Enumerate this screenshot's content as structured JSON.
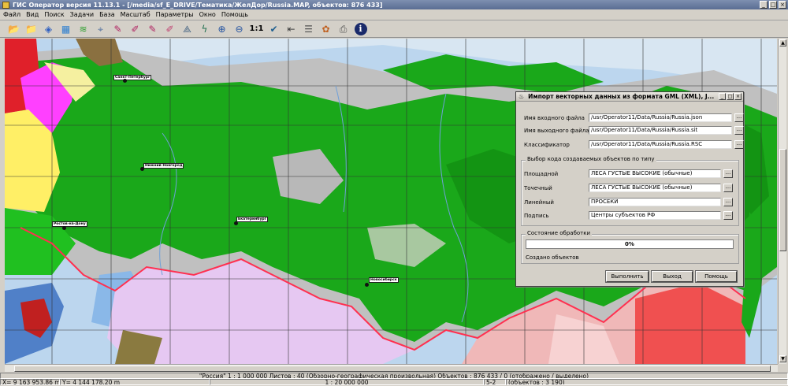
{
  "window": {
    "title": "ГИС Оператор версия 11.13.1 - [/media/sf_E_DRIVE/Тематика/ЖелДор/Russia.MAP, объектов: 876 433]",
    "buttons": [
      "_",
      "□",
      "×"
    ]
  },
  "menu": [
    "Файл",
    "Вид",
    "Поиск",
    "Задачи",
    "База",
    "Масштаб",
    "Параметры",
    "Окно",
    "Помощь"
  ],
  "toolbar": {
    "icons": [
      "open-folder-icon",
      "open-map-icon",
      "layers-icon",
      "select-icon",
      "palette-icon",
      "select-object-icon",
      "marker-icon",
      "marker-list-icon",
      "marker-add-icon",
      "marker-remove-icon",
      "measure-icon",
      "lightning-icon",
      "zoom-in-icon",
      "zoom-out-icon",
      "check-icon",
      "back-arrow-icon",
      "document-icon",
      "paint-icon",
      "print-icon",
      "info-icon"
    ],
    "scale_label": "1:1"
  },
  "map": {
    "cities": [
      "Санкт-Петербург",
      "Нижний Новгород",
      "Ростов-на-Дону",
      "Екатеринбург",
      "Новосибирск"
    ],
    "colors": {
      "sea": "#bcd6ee",
      "forest": "#1aa81a",
      "land": "#c0c0c0",
      "border": "#ff3050",
      "kazakhstan": "#e6c8f2",
      "china": "#f0b8b8"
    }
  },
  "dialog": {
    "title": "Импорт векторных данных из формата GML (XML), J...",
    "fields": [
      {
        "label": "Имя входного файла",
        "value": "/usr/Operator11/Data/Russia/Russia.json"
      },
      {
        "label": "Имя выходного файла",
        "value": "/usr/Operator11/Data/Russia/Russia.sit"
      },
      {
        "label": "Классификатор",
        "value": "/usr/Operator11/Data/Russia/Russia.RSC"
      }
    ],
    "type_group": {
      "title": "Выбор кода создаваемых объектов по типу",
      "rows": [
        {
          "label": "Площадной",
          "value": "ЛЕСА ГУСТЫЕ ВЫСОКИЕ (обычные)"
        },
        {
          "label": "Точечный",
          "value": "ЛЕСА ГУСТЫЕ ВЫСОКИЕ (обычные)"
        },
        {
          "label": "Линейный",
          "value": "ПРОСЕКИ"
        },
        {
          "label": "Подпись",
          "value": "Центры субъектов РФ"
        }
      ]
    },
    "state_group": {
      "title": "Состояние обработки",
      "progress_text": "0%",
      "progress": 0,
      "created_label": "Создано объектов"
    },
    "buttons": {
      "run": "Выполнить",
      "exit": "Выход",
      "help": "Помощь"
    },
    "browse_label": "..."
  },
  "status": {
    "row1": [
      "\"Россия\"  1 : 1 000 000   Листов : 40   (Обзорно-географическая произвольная)  Объектов : 876 433 / 0 (отображено / выделено)"
    ],
    "row2": [
      "X= 9 163 953.86 m",
      "Y= 4 144 178.20 m",
      "1 : 20 000 000",
      "5-2",
      "(объектов : 3 190)"
    ]
  }
}
